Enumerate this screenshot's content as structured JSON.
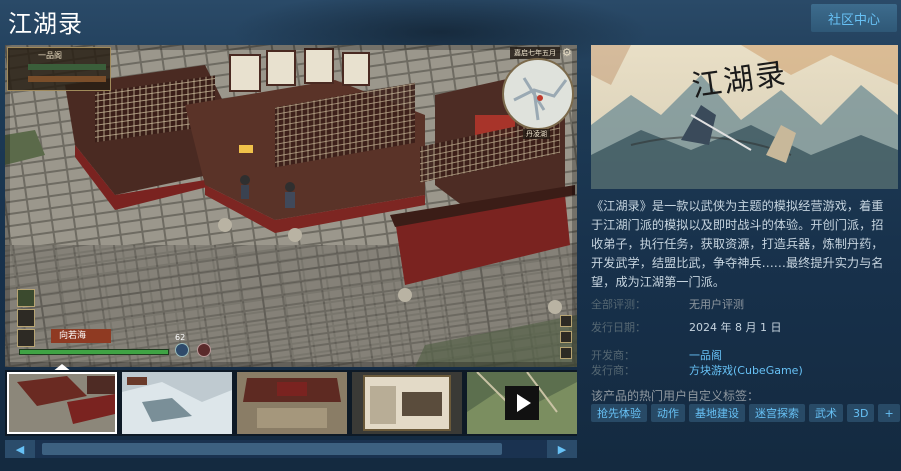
{
  "header": {
    "title": "江湖录",
    "community_button": "社区中心"
  },
  "screenshot_hud": {
    "sect_name": "一品阁",
    "date": "嘉启七年五月",
    "map_label": "丹凌湖",
    "character_name": "向若海",
    "hud_value": "62"
  },
  "thumbnails": [
    {
      "name": "screenshot-1",
      "active": true
    },
    {
      "name": "screenshot-2",
      "active": false
    },
    {
      "name": "screenshot-3",
      "active": false
    },
    {
      "name": "screenshot-4",
      "active": false
    },
    {
      "name": "video",
      "active": false
    }
  ],
  "scroll": {
    "left": "◀",
    "right": "▶"
  },
  "capsule": {
    "logo_text": "江湖录"
  },
  "description": "《江湖录》是一款以武侠为主题的模拟经营游戏，着重于江湖门派的模拟以及即时战斗的体验。开创门派，招收弟子，执行任务，获取资源，打造兵器，炼制丹药，开发武学，结盟比武，争夺神兵……最终提升实力与名望，成为江湖第一门派。",
  "meta": {
    "reviews_label": "全部评测：",
    "reviews_value": "无用户评测",
    "release_label": "发行日期：",
    "release_value": "2024 年 8 月 1 日",
    "developer_label": "开发商：",
    "developer_value": "一品阁",
    "publisher_label": "发行商：",
    "publisher_value": "方块游戏(CubeGame)"
  },
  "tags_label": "该产品的热门用户自定义标签：",
  "tags": [
    "抢先体验",
    "动作",
    "基地建设",
    "迷宫探索",
    "武术",
    "3D",
    "+"
  ],
  "colors": {
    "background": "#1b2838",
    "accent": "#67c1f5",
    "tag_bg": "#284a66"
  }
}
